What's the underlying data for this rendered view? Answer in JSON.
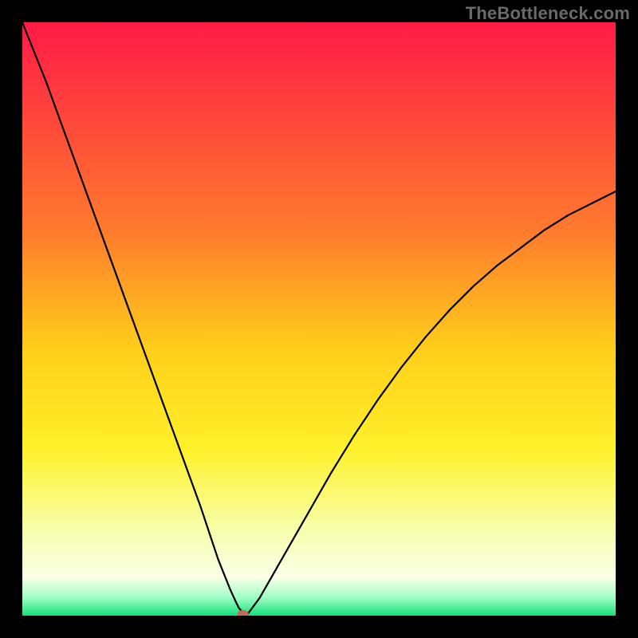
{
  "watermark": "TheBottleneck.com",
  "chart_data": {
    "type": "line",
    "title": "",
    "xlabel": "",
    "ylabel": "",
    "xlim": [
      0,
      100
    ],
    "ylim": [
      0,
      100
    ],
    "gradient_stops": [
      {
        "offset": 0.0,
        "color": "#ff1a46"
      },
      {
        "offset": 0.35,
        "color": "#ff7a2e"
      },
      {
        "offset": 0.55,
        "color": "#ffce1a"
      },
      {
        "offset": 0.72,
        "color": "#fff12a"
      },
      {
        "offset": 0.86,
        "color": "#f7ffb0"
      },
      {
        "offset": 0.935,
        "color": "#fbffe6"
      },
      {
        "offset": 0.97,
        "color": "#9fffc5"
      },
      {
        "offset": 1.0,
        "color": "#11e07a"
      }
    ],
    "series": [
      {
        "name": "bottleneck-curve",
        "x": [
          0,
          2,
          4,
          6,
          8,
          10,
          12,
          14,
          16,
          18,
          20,
          22,
          24,
          26,
          28,
          30,
          32,
          33,
          34,
          35,
          36,
          36.5,
          37,
          37.5,
          38,
          40,
          44,
          48,
          52,
          56,
          60,
          64,
          68,
          72,
          76,
          80,
          84,
          88,
          92,
          96,
          100
        ],
        "y": [
          100,
          95,
          90,
          84.5,
          79,
          73.5,
          68,
          62.5,
          57,
          51.5,
          46,
          40.5,
          35,
          29.5,
          24,
          18.5,
          12.5,
          9.5,
          7,
          4.5,
          2.3,
          1.3,
          0.7,
          0.3,
          0.3,
          3,
          10,
          17,
          24,
          30.5,
          36.5,
          42,
          47,
          51.5,
          55.5,
          59,
          62,
          65,
          67.5,
          69.5,
          71.5
        ]
      }
    ],
    "marker": {
      "x": 37.2,
      "y": 0.3,
      "color": "#c46a5a",
      "rx": 7,
      "ry": 5
    }
  }
}
